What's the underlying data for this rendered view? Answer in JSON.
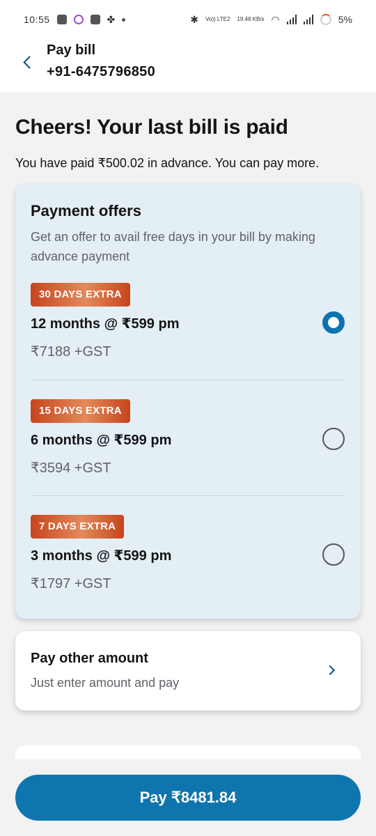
{
  "status_bar": {
    "time": "10:55",
    "network_labels": [
      "Vo)) LTE2",
      "19.48 KB/s"
    ],
    "battery": "5%"
  },
  "header": {
    "title": "Pay bill",
    "phone": "+91-6475796850"
  },
  "main": {
    "headline": "Cheers! Your last bill is paid",
    "subline": "You have paid ₹500.02 in advance. You can pay more."
  },
  "offers": {
    "title": "Payment offers",
    "description": "Get an offer to avail free days in your bill by making advance payment",
    "items": [
      {
        "badge": "30 DAYS EXTRA",
        "plan": "12 months @ ₹599 pm",
        "price": "₹7188 +GST",
        "selected": true
      },
      {
        "badge": "15 DAYS EXTRA",
        "plan": "6 months @ ₹599 pm",
        "price": "₹3594 +GST",
        "selected": false
      },
      {
        "badge": "7 DAYS EXTRA",
        "plan": "3 months @ ₹599 pm",
        "price": "₹1797 +GST",
        "selected": false
      }
    ]
  },
  "other_amount": {
    "title": "Pay other amount",
    "description": "Just enter amount and pay"
  },
  "pay_button": {
    "label": "Pay ₹8481.84"
  },
  "colors": {
    "accent": "#0f75ae",
    "badge": "#c8441c",
    "card_bg": "#e4eef5",
    "page_bg": "#f2f2f2"
  },
  "icons": {
    "back": "chevron-left-icon",
    "other_amount": "chevron-right-icon",
    "radio_selected": "radio-selected-icon",
    "radio_unselected": "radio-unselected-icon"
  }
}
